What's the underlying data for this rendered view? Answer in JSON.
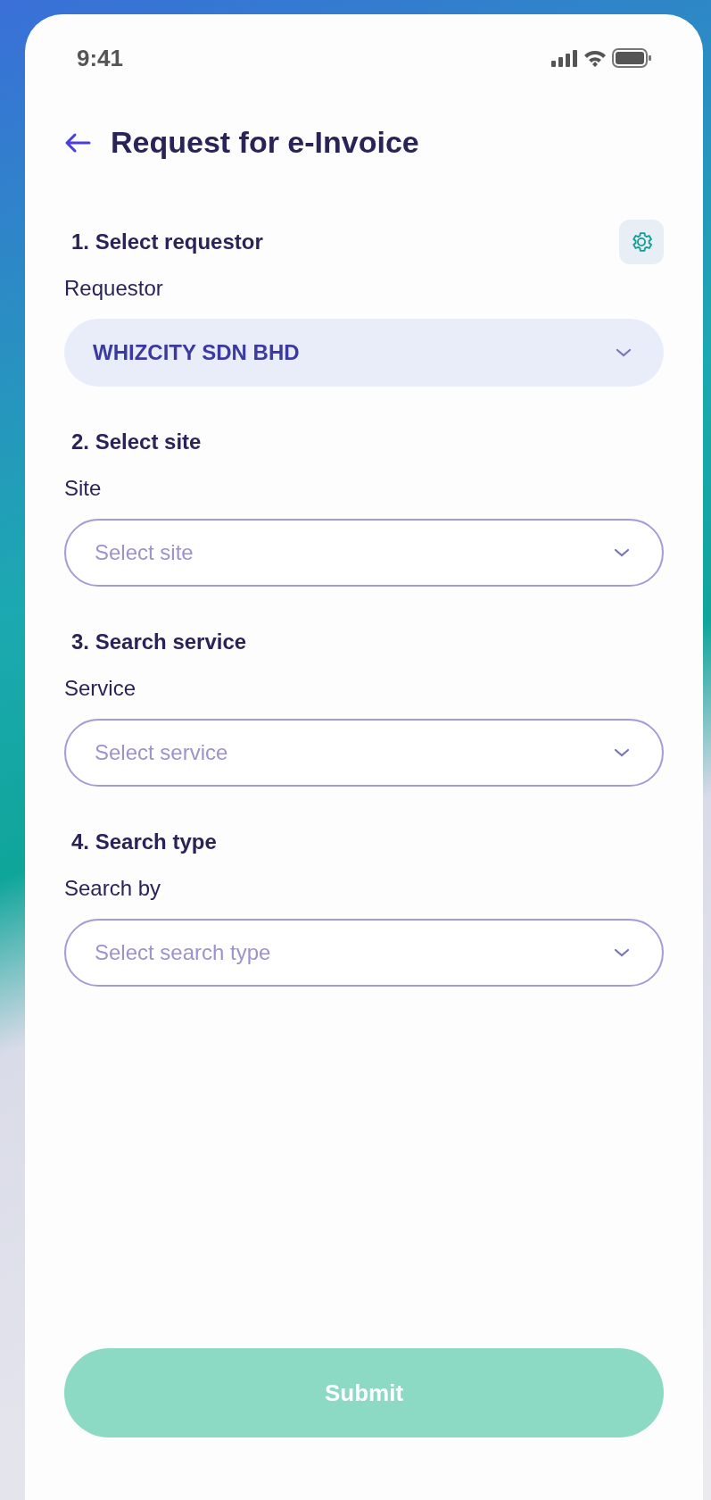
{
  "status_bar": {
    "time": "9:41"
  },
  "header": {
    "title": "Request for e-Invoice"
  },
  "sections": [
    {
      "title": "1. Select requestor",
      "has_settings": true,
      "label": "Requestor",
      "field": {
        "value": "WHIZCITY SDN BHD"
      }
    },
    {
      "title": "2. Select site",
      "has_settings": false,
      "label": "Site",
      "field": {
        "placeholder": "Select site"
      }
    },
    {
      "title": "3. Search service",
      "has_settings": false,
      "label": "Service",
      "field": {
        "placeholder": "Select service"
      }
    },
    {
      "title": "4. Search type",
      "has_settings": false,
      "label": "Search by",
      "field": {
        "placeholder": "Select search type"
      }
    }
  ],
  "submit": {
    "label": "Submit",
    "disabled": true
  }
}
